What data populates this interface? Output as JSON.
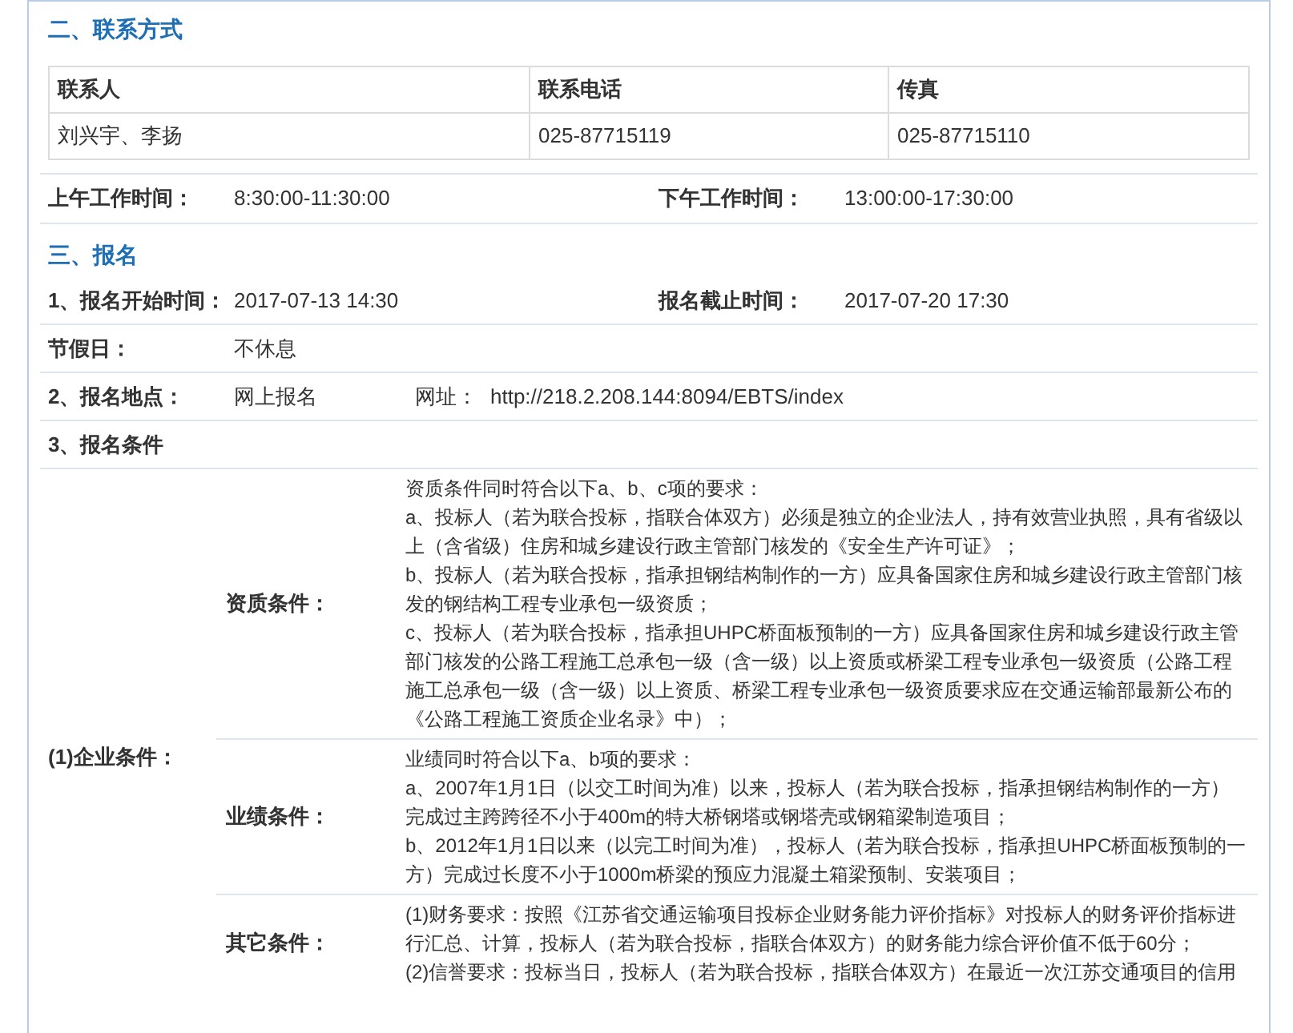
{
  "contact": {
    "title": "二、联系方式",
    "columns": [
      "联系人",
      "联系电话",
      "传真"
    ],
    "rows": [
      [
        "刘兴宇、李扬",
        "025-87715119",
        "025-87715110"
      ]
    ]
  },
  "work_hours": [
    {
      "label": "上午工作时间：",
      "value": "8:30:00-11:30:00"
    },
    {
      "label": "下午工作时间：",
      "value": "13:00:00-17:30:00"
    }
  ],
  "registration": {
    "title": "三、报名",
    "times": [
      {
        "label": "1、报名开始时间：",
        "value": "2017-07-13 14:30"
      },
      {
        "label": "报名截止时间：",
        "value": "2017-07-20 17:30"
      }
    ],
    "holiday": {
      "label": "节假日：",
      "value": "不休息"
    },
    "place": {
      "label": "2、报名地点：",
      "value": "网上报名",
      "url_label": "网址：",
      "url": "http://218.2.208.144:8094/EBTS/index"
    },
    "conditions_title": "3、报名条件",
    "enterprise": {
      "label": "(1)企业条件：",
      "items": [
        {
          "label": "资质条件：",
          "lines": [
            "资质条件同时符合以下a、b、c项的要求：",
            "a、投标人（若为联合投标，指联合体双方）必须是独立的企业法人，持有效营业执照，具有省级以上（含省级）住房和城乡建设行政主管部门核发的《安全生产许可证》；",
            "b、投标人（若为联合投标，指承担钢结构制作的一方）应具备国家住房和城乡建设行政主管部门核发的钢结构工程专业承包一级资质；",
            "c、投标人（若为联合投标，指承担UHPC桥面板预制的一方）应具备国家住房和城乡建设行政主管部门核发的公路工程施工总承包一级（含一级）以上资质或桥梁工程专业承包一级资质（公路工程施工总承包一级（含一级）以上资质、桥梁工程专业承包一级资质要求应在交通运输部最新公布的《公路工程施工资质企业名录》中）；"
          ]
        },
        {
          "label": "业绩条件：",
          "lines": [
            "业绩同时符合以下a、b项的要求：",
            "a、2007年1月1日（以交工时间为准）以来，投标人（若为联合投标，指承担钢结构制作的一方）完成过主跨跨径不小于400m的特大桥钢塔或钢塔壳或钢箱梁制造项目；",
            "b、2012年1月1日以来（以完工时间为准），投标人（若为联合投标，指承担UHPC桥面板预制的一方）完成过长度不小于1000m桥梁的预应力混凝土箱梁预制、安装项目；"
          ]
        },
        {
          "label": "其它条件：",
          "lines": [
            "(1)财务要求：按照《江苏省交通运输项目投标企业财务能力评价指标》对投标人的财务评价指标进行汇总、计算，投标人（若为联合投标，指联合体双方）的财务能力综合评价值不低于60分；",
            "(2)信誉要求：投标当日，投标人（若为联合投标，指联合体双方）在最近一次江苏交通项目的信用"
          ]
        }
      ]
    }
  }
}
